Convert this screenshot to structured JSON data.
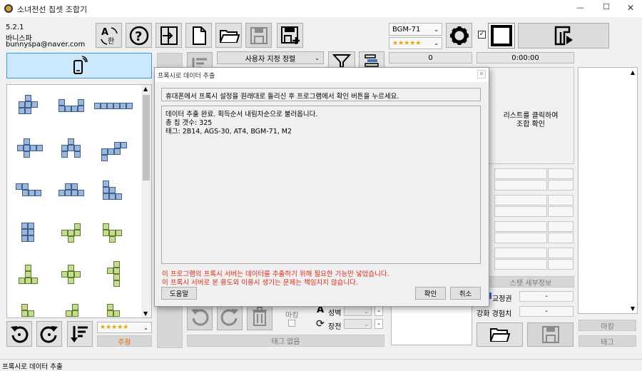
{
  "window": {
    "title": "소녀전선 칩셋 조합기",
    "min": "—",
    "max": "☐",
    "close": "✕"
  },
  "info": {
    "version": "5.2.1",
    "author": "바니스파",
    "email": "bunnyspa@naver.com"
  },
  "toolbar": {
    "doll_select": "BGM-71",
    "stars_select": "★★★★★",
    "count_value": "0",
    "time_value": "0:00:00",
    "sort_select": "사용자 지정 정렬"
  },
  "left": {
    "stars_select": "★★★★★",
    "color_button": "주황"
  },
  "right_panel": {
    "combo_hint_line1": "리스트를 클릭하여",
    "combo_hint_line2": "조합 확인",
    "chip_detail_button": "스탯 세부정보",
    "calibration_label": "교정권",
    "calibration_value": "-",
    "upgrade_exp_label": "강화 경험치",
    "upgrade_exp_value": "-",
    "mark_button": "마킹",
    "tag_button": "태그"
  },
  "center_bottom": {
    "mark_label": "마킹",
    "stat_label_1": "성벽",
    "stat_label_2": "장전",
    "tag_none_button": "태그 없음"
  },
  "dialog": {
    "title": "프록시로 데이터 추출",
    "instruction": "휴대폰에서 프록시 설정을 원래대로 돌리신 후 프로그램에서 확인 버튼을 누르세요.",
    "log_line1": "데이터 추출 완료. 획득순서 내림차순으로 불러옵니다.",
    "log_line2": "총 칩 갯수: 325",
    "log_line3": "태그: 2B14, AGS-30, AT4, BGM-71, M2",
    "warning_line1": "이 프로그램의 프록시 서버는 데이터를 추출하기 위해 필요한 기능만 넣었습니다.",
    "warning_line2": "이 프록시 서버로 본 용도외 이용시 생기는 문제는 책임지지 않습니다.",
    "help_button": "도움말",
    "ok_button": "확인",
    "cancel_button": "취소"
  },
  "status_bar": {
    "text": "프록시로 데이터 추출"
  },
  "colors": {
    "chip_blue": "#9bb7dc",
    "chip_green": "#c3dc8f",
    "warning_red": "#e0271a",
    "selected_blue": "#cce8ff"
  }
}
